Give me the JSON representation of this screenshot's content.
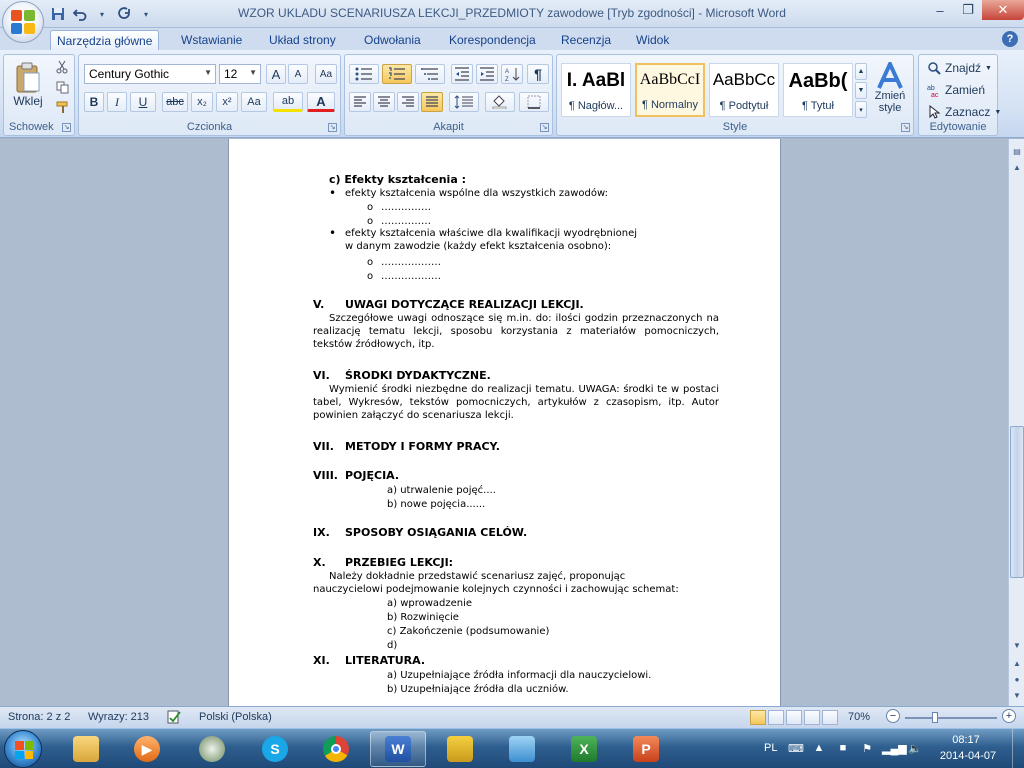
{
  "window": {
    "title": "WZOR UKLADU SCENARIUSZA LEKCJI_PRZEDMIOTY zawodowe [Tryb zgodności] - Microsoft Word",
    "minimize": "–",
    "maximize": "❐",
    "close": "✕"
  },
  "qat": {
    "save": "💾",
    "undo": "↶",
    "redo": "↻",
    "more": "▾"
  },
  "tabs": [
    "Narzędzia główne",
    "Wstawianie",
    "Układ strony",
    "Odwołania",
    "Korespondencja",
    "Recenzja",
    "Widok"
  ],
  "help": "?",
  "ribbon": {
    "clipboard": {
      "label": "Schowek",
      "paste": "Wklej"
    },
    "font": {
      "label": "Czcionka",
      "name": "Century Gothic",
      "size": "12",
      "grow": "A",
      "shrink": "A",
      "clear": "Aa",
      "bold": "B",
      "italic": "I",
      "underline": "U",
      "strike": "abc",
      "subscript": "x₂",
      "superscript": "x²",
      "case": "Aa",
      "highlight": "ab",
      "color": "A"
    },
    "paragraph": {
      "label": "Akapit",
      "pilcrow": "¶"
    },
    "styles": {
      "label": "Style",
      "tiles": [
        {
          "sample": "I. AaBl",
          "name": "¶ Nagłów..."
        },
        {
          "sample": "AaBbCcI",
          "name": "¶ Normalny"
        },
        {
          "sample": "AaBbCc",
          "name": "¶ Podtytuł"
        },
        {
          "sample": "AaBb(",
          "name": "¶ Tytuł"
        }
      ],
      "change": "Zmień style"
    },
    "editing": {
      "label": "Edytowanie",
      "find": "Znajdź",
      "replace": "Zamień",
      "select": "Zaznacz"
    }
  },
  "document": {
    "c_heading": "c) Efekty kształcenia :",
    "bullet1": "efekty kształcenia wspólne dla wszystkich zawodów:",
    "sub1a": "……………",
    "sub1b": "……………",
    "bullet2_line1": "efekty kształcenia właściwe dla kwalifikacji wyodrębnionej",
    "bullet2_line2": "w danym zawodzie  (każdy efekt kształcenia osobno):",
    "sub2a": "………………",
    "sub2b": "………………",
    "sec5_num": "V.",
    "sec5_title": "UWAGI DOTYCZĄCE REALIZACJI LEKCJI.",
    "sec5_text": "Szczegółowe uwagi odnoszące się m.in. do: ilości godzin przeznaczonych na realizację tematu lekcji, sposobu korzystania z materiałów pomocniczych, tekstów źródłowych, itp.",
    "sec6_num": "VI.",
    "sec6_title": "ŚRODKI DYDAKTYCZNE.",
    "sec6_text": "Wymienić środki niezbędne do realizacji tematu. UWAGA: środki te w postaci tabel, Wykresów, tekstów pomocniczych, artykułów z czasopism, itp. Autor powinien załączyć do scenariusza lekcji.",
    "sec7_num": "VII.",
    "sec7_title": "METODY I FORMY PRACY.",
    "sec8_num": "VIII.",
    "sec8_title": "POJĘCIA.",
    "sec8_a": "a)  utrwalenie pojęć....",
    "sec8_b": "b)  nowe pojęcia......",
    "sec9_num": "IX.",
    "sec9_title": "SPOSOBY OSIĄGANIA CELÓW.",
    "sec10_num": "X.",
    "sec10_title": "PRZEBIEG LEKCJI:",
    "sec10_line1": "Należy   dokładnie   przedstawić   scenariusz   zajęć,   proponując",
    "sec10_line2": "nauczycielowi podejmowanie kolejnych czynności i zachowując schemat:",
    "sec10_a": "a)  wprowadzenie",
    "sec10_b": "b)  Rozwinięcie",
    "sec10_c": "c)  Zakończenie  (podsumowanie)",
    "sec10_d": "d)",
    "sec11_num": "XI.",
    "sec11_title": "LITERATURA.",
    "sec11_a": "a)  Uzupełniające  źródła informacji dla nauczycielowi.",
    "sec11_b": "b)  Uzupełniające źródła dla uczniów."
  },
  "status": {
    "page": "Strona: 2 z 2",
    "words": "Wyrazy: 213",
    "language": "Polski (Polska)",
    "zoom": "70%",
    "zoom_minus": "−",
    "zoom_plus": "+"
  },
  "tray": {
    "lang": "PL",
    "time": "08:17",
    "date": "2014-04-07"
  },
  "colors": {
    "accent": "#15428b",
    "ribbon": "#dbe6f5",
    "taskbar": "#2f5f8f"
  }
}
